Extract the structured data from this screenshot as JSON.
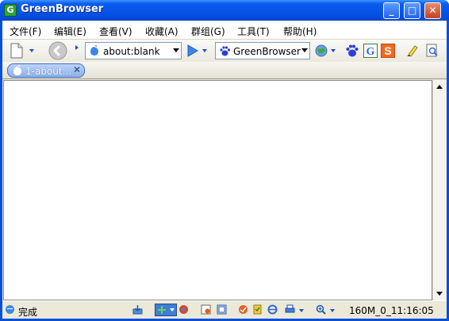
{
  "window": {
    "title": "GreenBrowser",
    "app_icon_letter": "G"
  },
  "caption": {
    "minimize": "_",
    "maximize": "□",
    "close": "✕"
  },
  "menubar": {
    "items": [
      {
        "label": "文件(F)"
      },
      {
        "label": "编辑(E)"
      },
      {
        "label": "查看(V)"
      },
      {
        "label": "收藏(A)"
      },
      {
        "label": "群组(G)"
      },
      {
        "label": "工具(T)"
      },
      {
        "label": "帮助(H)"
      }
    ]
  },
  "toolbar": {
    "address": {
      "value": "about:blank"
    },
    "search_engine": {
      "value": "GreenBrowser"
    },
    "icons": [
      "new-page-icon",
      "back-icon",
      "go-icon",
      "search-baidu-icon",
      "globe-icon",
      "baidu-paw-icon",
      "google-g-icon",
      "sogou-s-icon",
      "highlighter-icon",
      "find-icon"
    ]
  },
  "tabs": [
    {
      "label": "1-about...",
      "close": "✕"
    }
  ],
  "statusbar": {
    "text": "完成",
    "clock": "160M_0_11:16:05"
  },
  "colors": {
    "title_bar": "#0653e6",
    "frame": "#ece9d8",
    "tab_active": "#8bb0ea"
  }
}
